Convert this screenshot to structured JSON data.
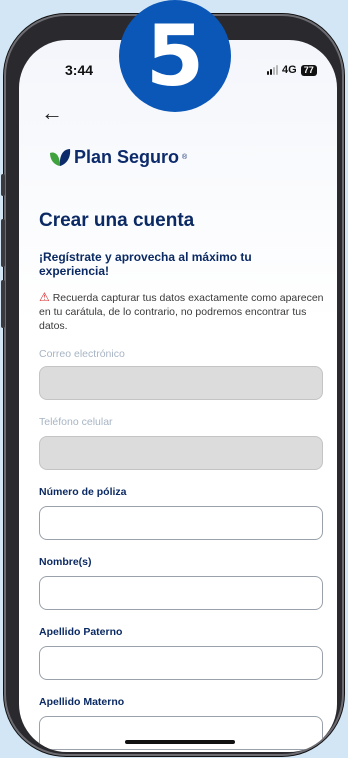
{
  "step_badge": "5",
  "status_bar": {
    "time": "3:44",
    "network": "4G",
    "battery": "77"
  },
  "header": {
    "brand_name": "Plan Seguro",
    "brand_mark": "®"
  },
  "main": {
    "title": "Crear una cuenta",
    "subtitle": "¡Regístrate y aprovecha al máximo tu experiencia!",
    "warning": "Recuerda capturar tus datos exactamente como aparecen en tu carátula, de lo contrario, no podremos encontrar tus datos."
  },
  "form": {
    "email_label": "Correo electrónico",
    "phone_label": "Teléfono celular",
    "policy_label": "Número de póliza",
    "name_label": "Nombre(s)",
    "paternal_label": "Apellido Paterno",
    "maternal_label": "Apellido Materno"
  },
  "colors": {
    "brand": "#0b2a63",
    "badge": "#0b57b8",
    "leaf_green": "#3fa23d",
    "warning": "#d62b2b"
  }
}
